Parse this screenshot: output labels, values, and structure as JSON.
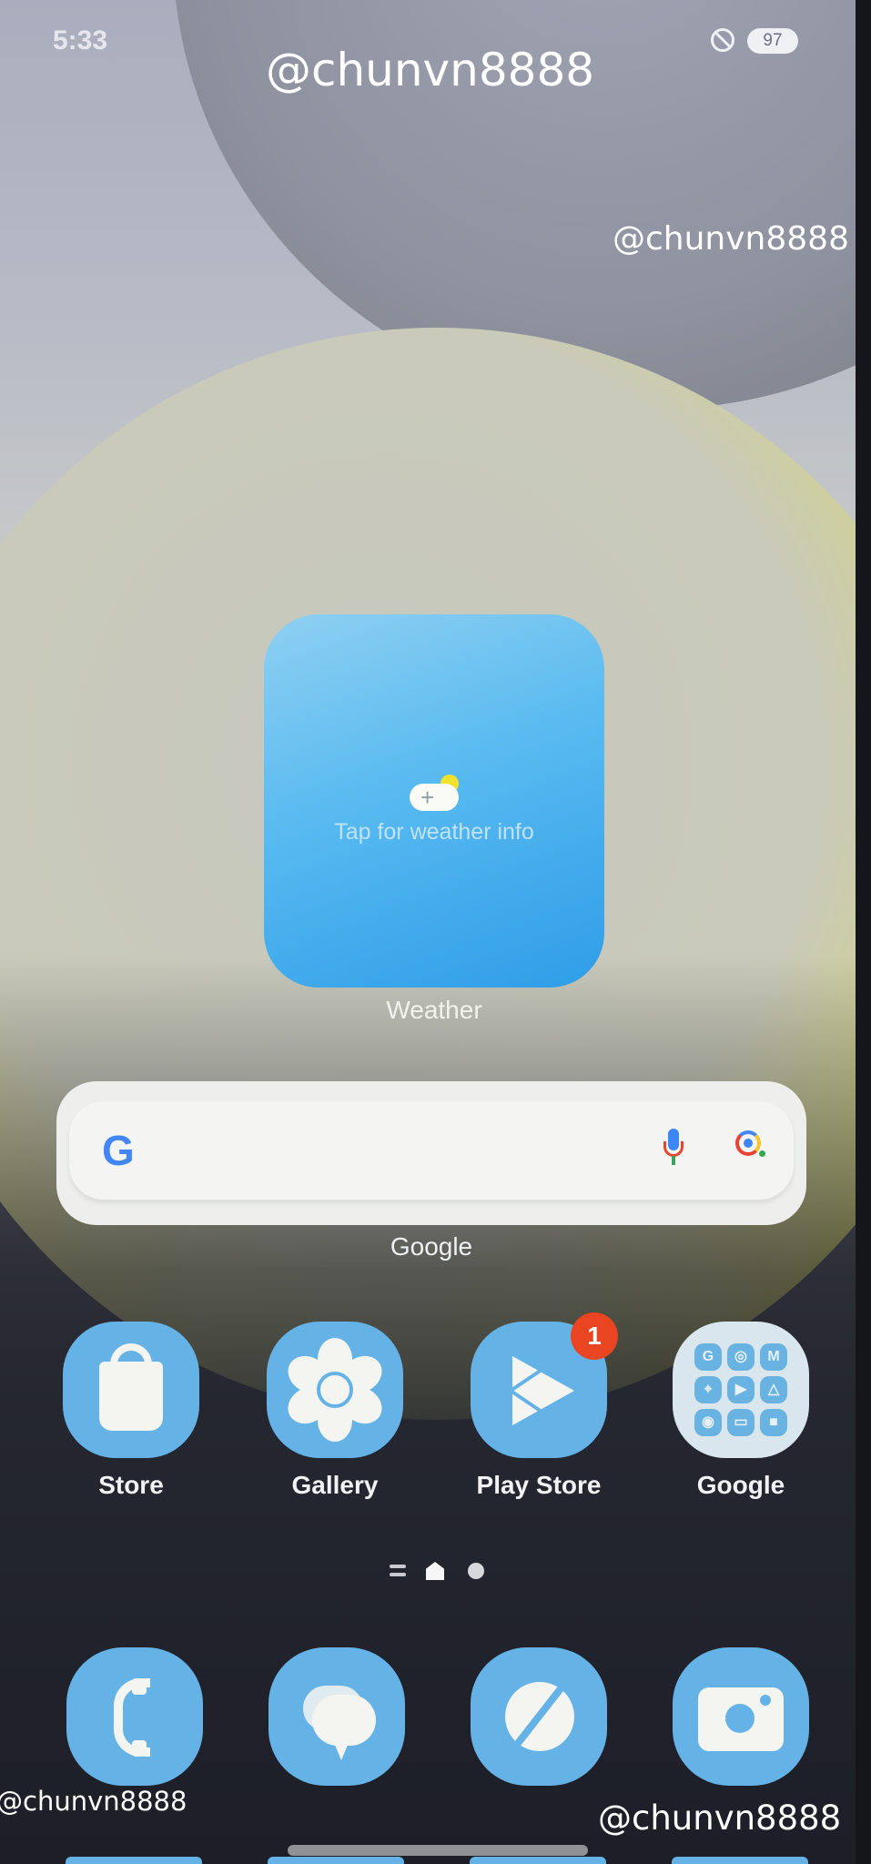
{
  "status_bar": {
    "time": "5:33",
    "dnd_icon": "do-not-disturb-icon",
    "battery_level": "97"
  },
  "watermarks": {
    "top": "@chunvn8888",
    "right": "@chunvn8888",
    "bottom_left": "@chunvn8888",
    "bottom_right": "@chunvn8888"
  },
  "weather_widget": {
    "icon": "cloud-sun-add-icon",
    "message": "Tap for weather info",
    "label": "Weather"
  },
  "search_widget": {
    "logo": "G",
    "mic_icon": "microphone-icon",
    "lens_icon": "google-lens-icon",
    "label": "Google"
  },
  "apps": [
    {
      "label": "Store",
      "icon": "shopping-bag-icon"
    },
    {
      "label": "Gallery",
      "icon": "flower-icon"
    },
    {
      "label": "Play Store",
      "icon": "play-store-icon",
      "badge": "1"
    },
    {
      "label": "Google",
      "icon": "folder-icon"
    }
  ],
  "google_folder_apps": [
    "G",
    "◎",
    "M",
    "⌖",
    "▶",
    "△",
    "◉",
    "▭",
    "■"
  ],
  "page_indicator": {
    "pages": [
      "list",
      "home",
      "page-2"
    ],
    "current": "home"
  },
  "dock": [
    {
      "name": "Phone",
      "icon": "phone-icon"
    },
    {
      "name": "Messages",
      "icon": "messages-icon"
    },
    {
      "name": "Internet",
      "icon": "internet-icon"
    },
    {
      "name": "Camera",
      "icon": "camera-icon"
    }
  ],
  "colors": {
    "icon_blue": "#65b3e6",
    "badge_red": "#ea4523",
    "weather_blue": "#3fa8ec",
    "yellow_accent": "#d9d84a"
  }
}
